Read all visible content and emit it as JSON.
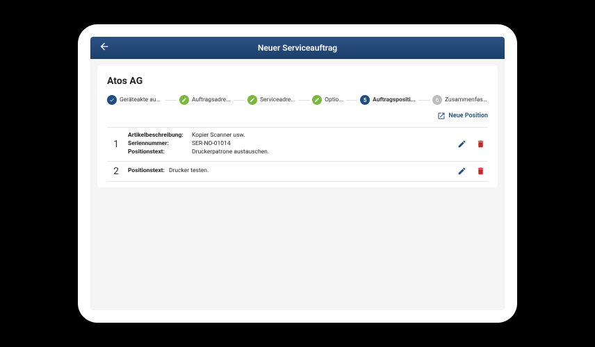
{
  "header": {
    "title": "Neuer Serviceauftrag"
  },
  "company": {
    "name": "Atos AG"
  },
  "steps": [
    {
      "label": "Geräteakte auswä...",
      "state": "done-blue"
    },
    {
      "label": "Auftragsadre...",
      "state": "done-green"
    },
    {
      "label": "Serviceadre...",
      "state": "done-green"
    },
    {
      "label": "Optio...",
      "state": "done-green"
    },
    {
      "label": "Auftragspositi...",
      "state": "active",
      "num": "5"
    },
    {
      "label": "Zusammenfass...",
      "state": "pending",
      "num": "6"
    }
  ],
  "actions": {
    "new_position": "Neue Position"
  },
  "labels": {
    "artikelbeschreibung": "Artikelbeschreibung:",
    "seriennummer": "Seriennummer:",
    "positionstext": "Positionstext:"
  },
  "positions": [
    {
      "num": "1",
      "artikelbeschreibung": "Kopier Scanner usw.",
      "seriennummer": "SER-NO-01014",
      "positionstext": "Druckerpatrone austauschen."
    },
    {
      "num": "2",
      "positionstext": "Drucker testen."
    }
  ]
}
